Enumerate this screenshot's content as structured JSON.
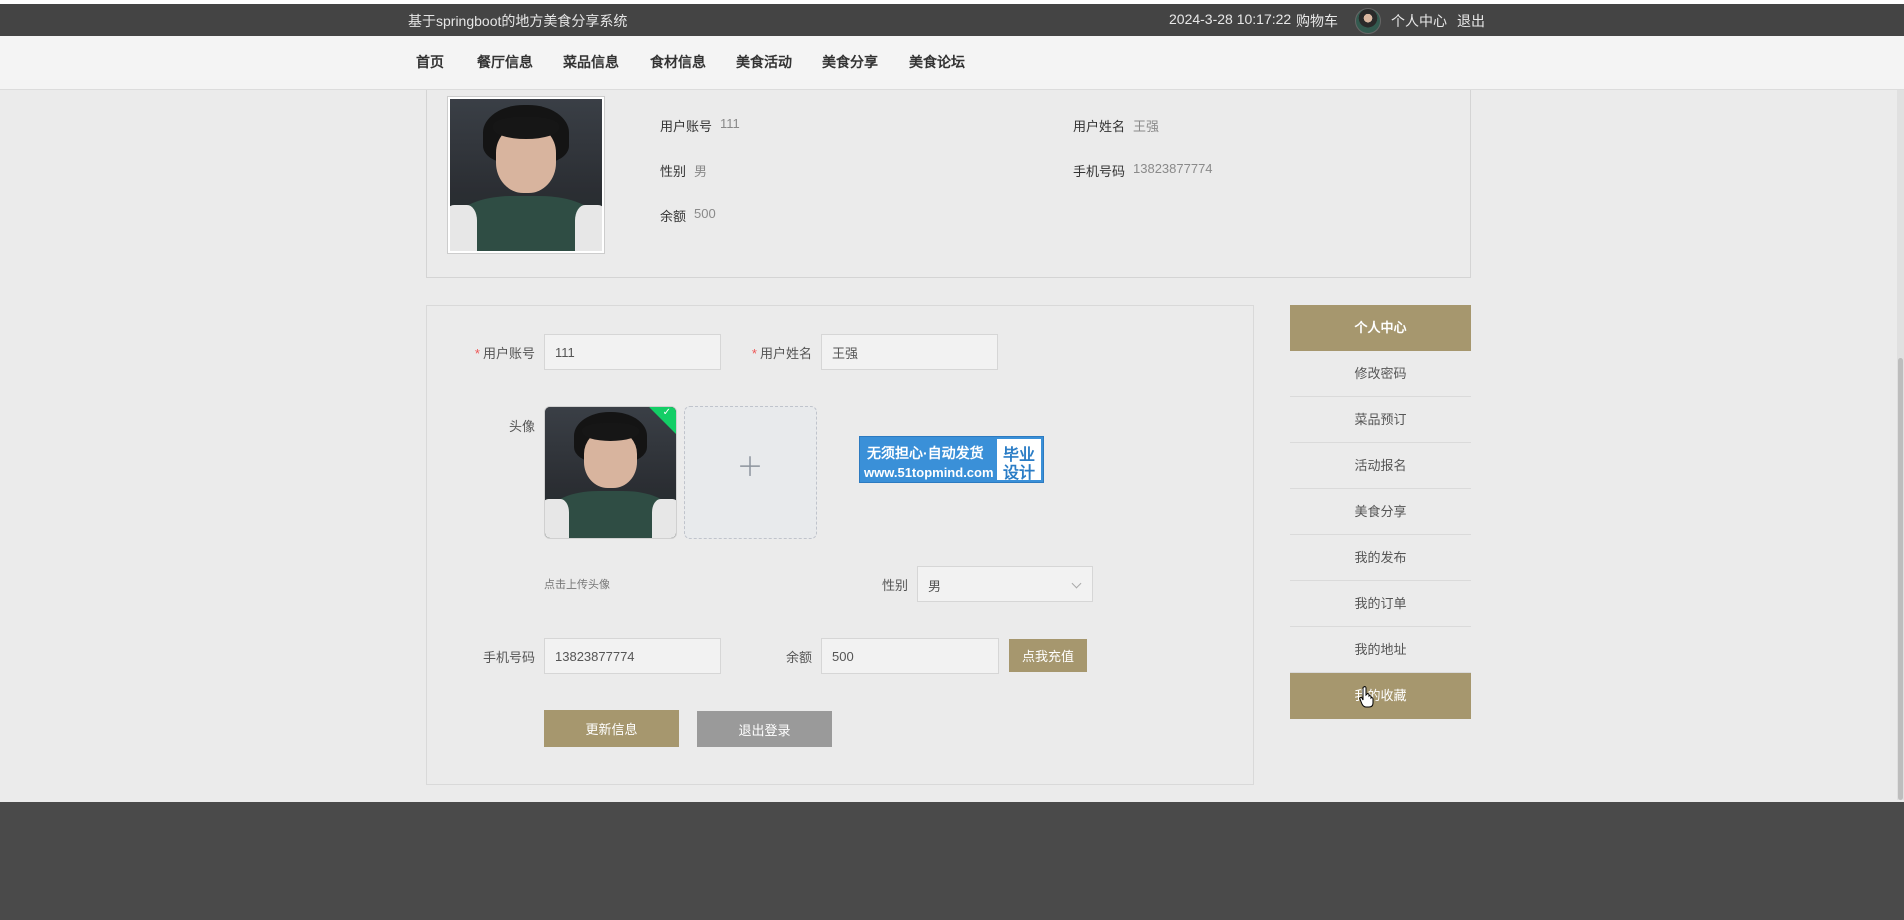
{
  "topbar": {
    "site_title": "基于springboot的地方美食分享系统",
    "datetime": "2024-3-28 10:17:22",
    "cart": "购物车",
    "profile": "个人中心",
    "logout": "退出"
  },
  "nav": {
    "items": [
      "首页",
      "餐厅信息",
      "菜品信息",
      "食材信息",
      "美食活动",
      "美食分享",
      "美食论坛"
    ]
  },
  "profile_card": {
    "account_label": "用户账号",
    "account_value": "111",
    "name_label": "用户姓名",
    "name_value": "王强",
    "gender_label": "性别",
    "gender_value": "男",
    "phone_label": "手机号码",
    "phone_value": "13823877774",
    "balance_label": "余额",
    "balance_value": "500"
  },
  "form": {
    "required_mark": "*",
    "account_label": "用户账号",
    "account_value": "111",
    "name_label": "用户姓名",
    "name_value": "王强",
    "avatar_label": "头像",
    "upload_hint": "点击上传头像",
    "upload_plus": "+",
    "gender_label": "性别",
    "gender_value": "男",
    "phone_label": "手机号码",
    "phone_value": "13823877774",
    "balance_label": "余额",
    "balance_value": "500",
    "recharge_button": "点我充值",
    "update_button": "更新信息",
    "logout_button": "退出登录"
  },
  "ad": {
    "line1": "无须担心·自动发货",
    "line2": "www.51topmind.com",
    "right_top": "毕业",
    "right_bottom": "设计"
  },
  "side_menu": {
    "items": [
      "个人中心",
      "修改密码",
      "菜品预订",
      "活动报名",
      "美食分享",
      "我的发布",
      "我的订单",
      "我的地址",
      "我的收藏"
    ]
  },
  "colors": {
    "accent": "#a6976e",
    "topbar": "#444444",
    "footer": "#4a4a4a",
    "success": "#13ce66",
    "ad_blue": "#3a90d8"
  }
}
